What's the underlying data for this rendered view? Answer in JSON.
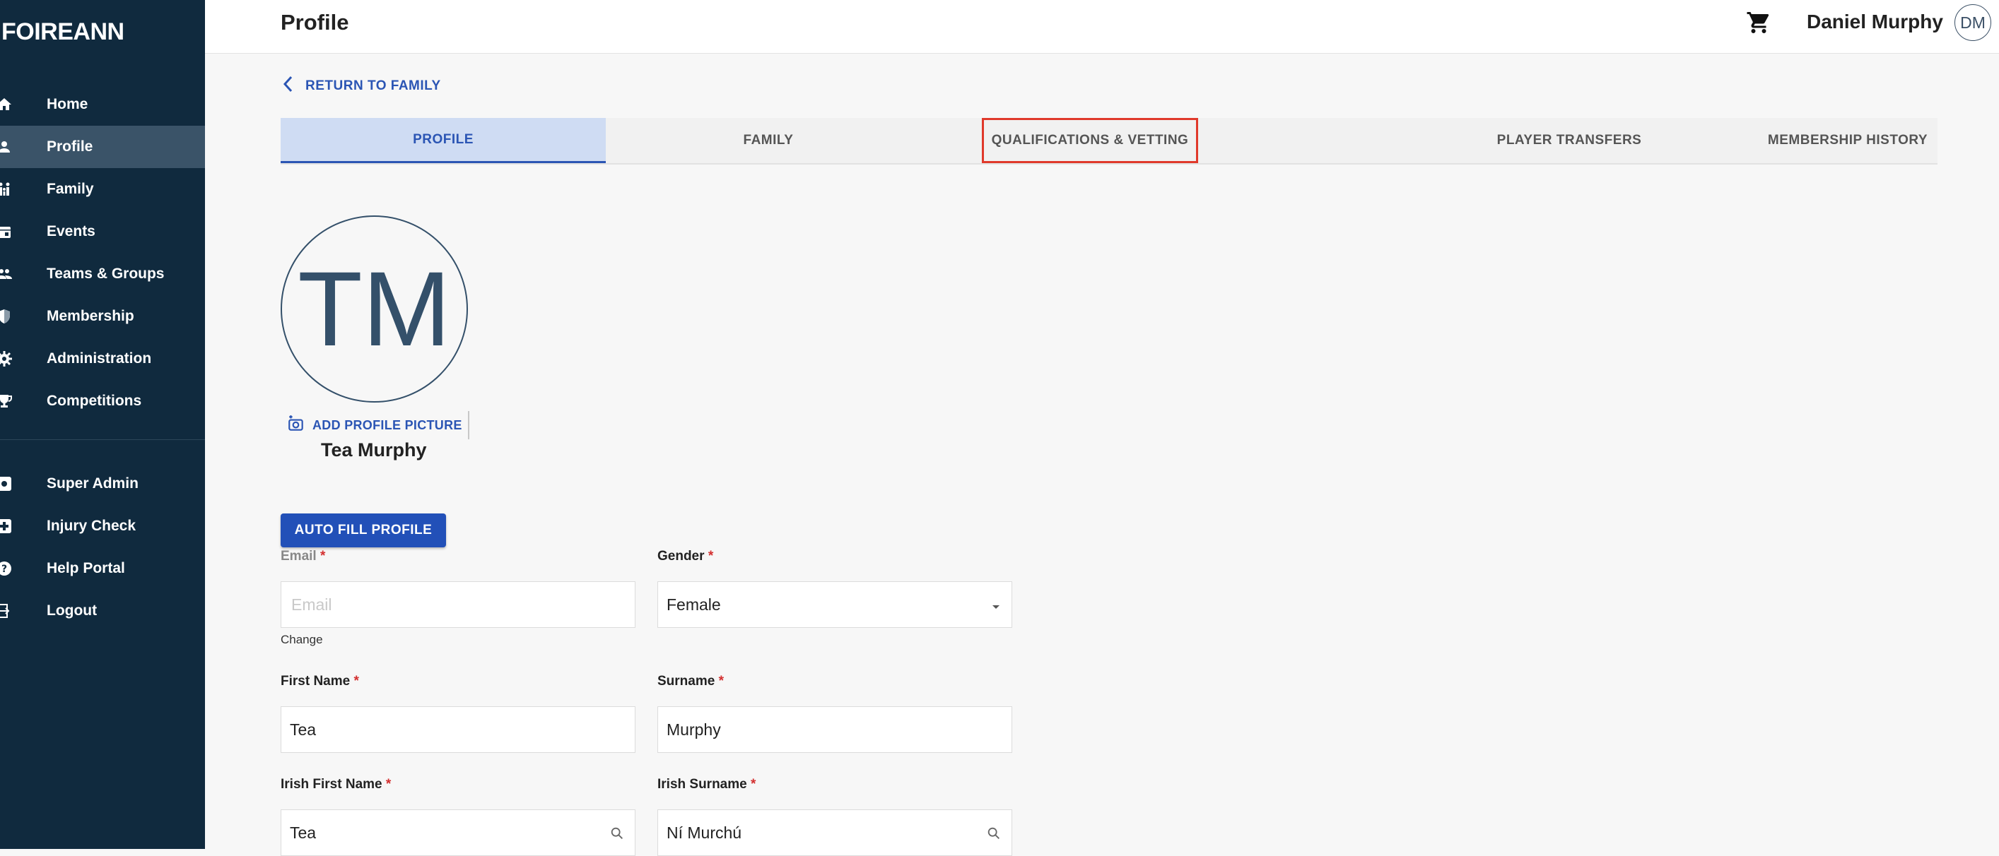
{
  "brand": {
    "logo_text": "FOIREANN"
  },
  "sidebar": {
    "items": [
      {
        "label": "Home",
        "icon": "home-icon"
      },
      {
        "label": "Profile",
        "icon": "person-icon",
        "active": true
      },
      {
        "label": "Family",
        "icon": "family-icon"
      },
      {
        "label": "Events",
        "icon": "calendar-icon"
      },
      {
        "label": "Teams & Groups",
        "icon": "groups-icon"
      },
      {
        "label": "Membership",
        "icon": "shield-icon"
      },
      {
        "label": "Administration",
        "icon": "gear-icon"
      },
      {
        "label": "Competitions",
        "icon": "trophy-icon"
      }
    ],
    "secondary": [
      {
        "label": "Super Admin",
        "icon": "admin-icon"
      },
      {
        "label": "Injury Check",
        "icon": "medical-icon"
      },
      {
        "label": "Help Portal",
        "icon": "help-icon"
      },
      {
        "label": "Logout",
        "icon": "logout-icon"
      }
    ]
  },
  "header": {
    "title": "Profile",
    "user_name": "Daniel Murphy",
    "user_initials": "DM"
  },
  "return_link": "RETURN TO FAMILY",
  "tabs": [
    {
      "label": "PROFILE",
      "active": true
    },
    {
      "label": "FAMILY"
    },
    {
      "label": "QUALIFICATIONS & VETTING",
      "highlighted": true
    },
    {
      "label": "PLAYER TRANSFERS"
    },
    {
      "label": "MEMBERSHIP HISTORY"
    }
  ],
  "profile": {
    "initials": "TM",
    "add_picture_label": "ADD PROFILE PICTURE",
    "name": "Tea Murphy"
  },
  "autofill_label": "AUTO FILL PROFILE",
  "form": {
    "email": {
      "label": "Email",
      "required": "*",
      "placeholder": "Email",
      "value": "",
      "change_link": "Change"
    },
    "gender": {
      "label": "Gender",
      "required": "*",
      "value": "Female"
    },
    "first_name": {
      "label": "First Name",
      "required": "*",
      "value": "Tea"
    },
    "surname": {
      "label": "Surname",
      "required": "*",
      "value": "Murphy"
    },
    "irish_first_name": {
      "label": "Irish First Name",
      "required": "*",
      "value": "Tea"
    },
    "irish_surname": {
      "label": "Irish Surname",
      "required": "*",
      "value": "Ní Murchú"
    }
  },
  "colors": {
    "sidebar_bg": "#102a3e",
    "accent": "#2b55b4",
    "highlight_outline": "#e0392b"
  }
}
